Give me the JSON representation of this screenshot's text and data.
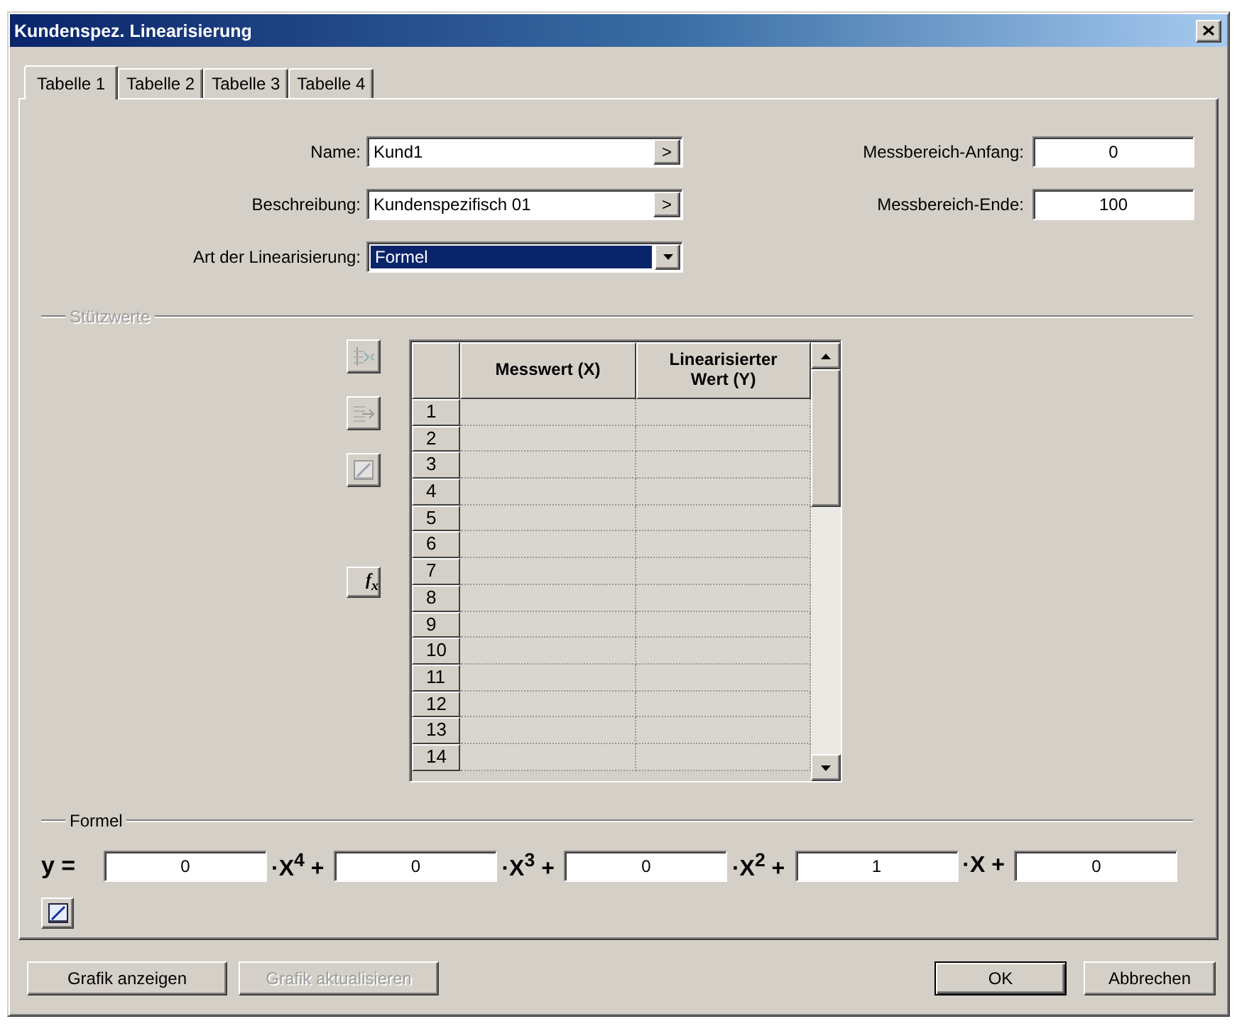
{
  "window": {
    "title": "Kundenspez. Linearisierung"
  },
  "tabs": [
    {
      "label": "Tabelle 1",
      "selected": true
    },
    {
      "label": "Tabelle 2",
      "selected": false
    },
    {
      "label": "Tabelle 3",
      "selected": false
    },
    {
      "label": "Tabelle 4",
      "selected": false
    }
  ],
  "fields": [
    {
      "kind": "browse",
      "label": "Name:",
      "value": "Kund1",
      "button": ">"
    },
    {
      "kind": "browse",
      "label": "Beschreibung:",
      "value": "Kundenspezifisch 01",
      "button": ">"
    },
    {
      "kind": "dropdown",
      "label": "Art der Linearisierung:",
      "value": "Formel",
      "highlighted": true
    }
  ],
  "range_fields": [
    {
      "label": "Messbereich-Anfang:",
      "value": "0"
    },
    {
      "label": "Messbereich-Ende:",
      "value": "100"
    }
  ],
  "support_points": {
    "title": "Stützwerte",
    "disabled": true,
    "tools": [
      {
        "kind": "delete-rows",
        "disabled": true
      },
      {
        "kind": "insert-rows",
        "disabled": true
      },
      {
        "kind": "chart",
        "disabled": true
      },
      {
        "kind": "formula",
        "label": "f$_{x}$",
        "disabled": false
      }
    ],
    "table": {
      "columns": [
        "Messwert (X)",
        "Linearisierter Wert (Y)"
      ],
      "rows": [
        "1",
        "2",
        "3",
        "4",
        "5",
        "6",
        "7",
        "8",
        "9",
        "10",
        "11",
        "12",
        "13",
        "14"
      ]
    }
  },
  "formula": {
    "title": "Formel",
    "disabled": false,
    "lead": "y =",
    "terms": [
      {
        "value": "0",
        "suffix": "·X$^{4}$ +"
      },
      {
        "value": "0",
        "suffix": "·X$^{3}$ +"
      },
      {
        "value": "0",
        "suffix": "·X$^{2}$ +"
      },
      {
        "value": "1",
        "suffix": "·X +"
      },
      {
        "value": "0"
      }
    ],
    "tool": {
      "kind": "chart",
      "disabled": false
    }
  },
  "left_buttons": [
    {
      "label": "Grafik anzeigen",
      "disabled": false,
      "default": false
    },
    {
      "label": "Grafik aktualisieren",
      "disabled": true,
      "default": false
    }
  ],
  "right_buttons": [
    {
      "label": "OK",
      "disabled": false,
      "default": true
    },
    {
      "label": "Abbrechen",
      "disabled": false,
      "default": false
    }
  ]
}
